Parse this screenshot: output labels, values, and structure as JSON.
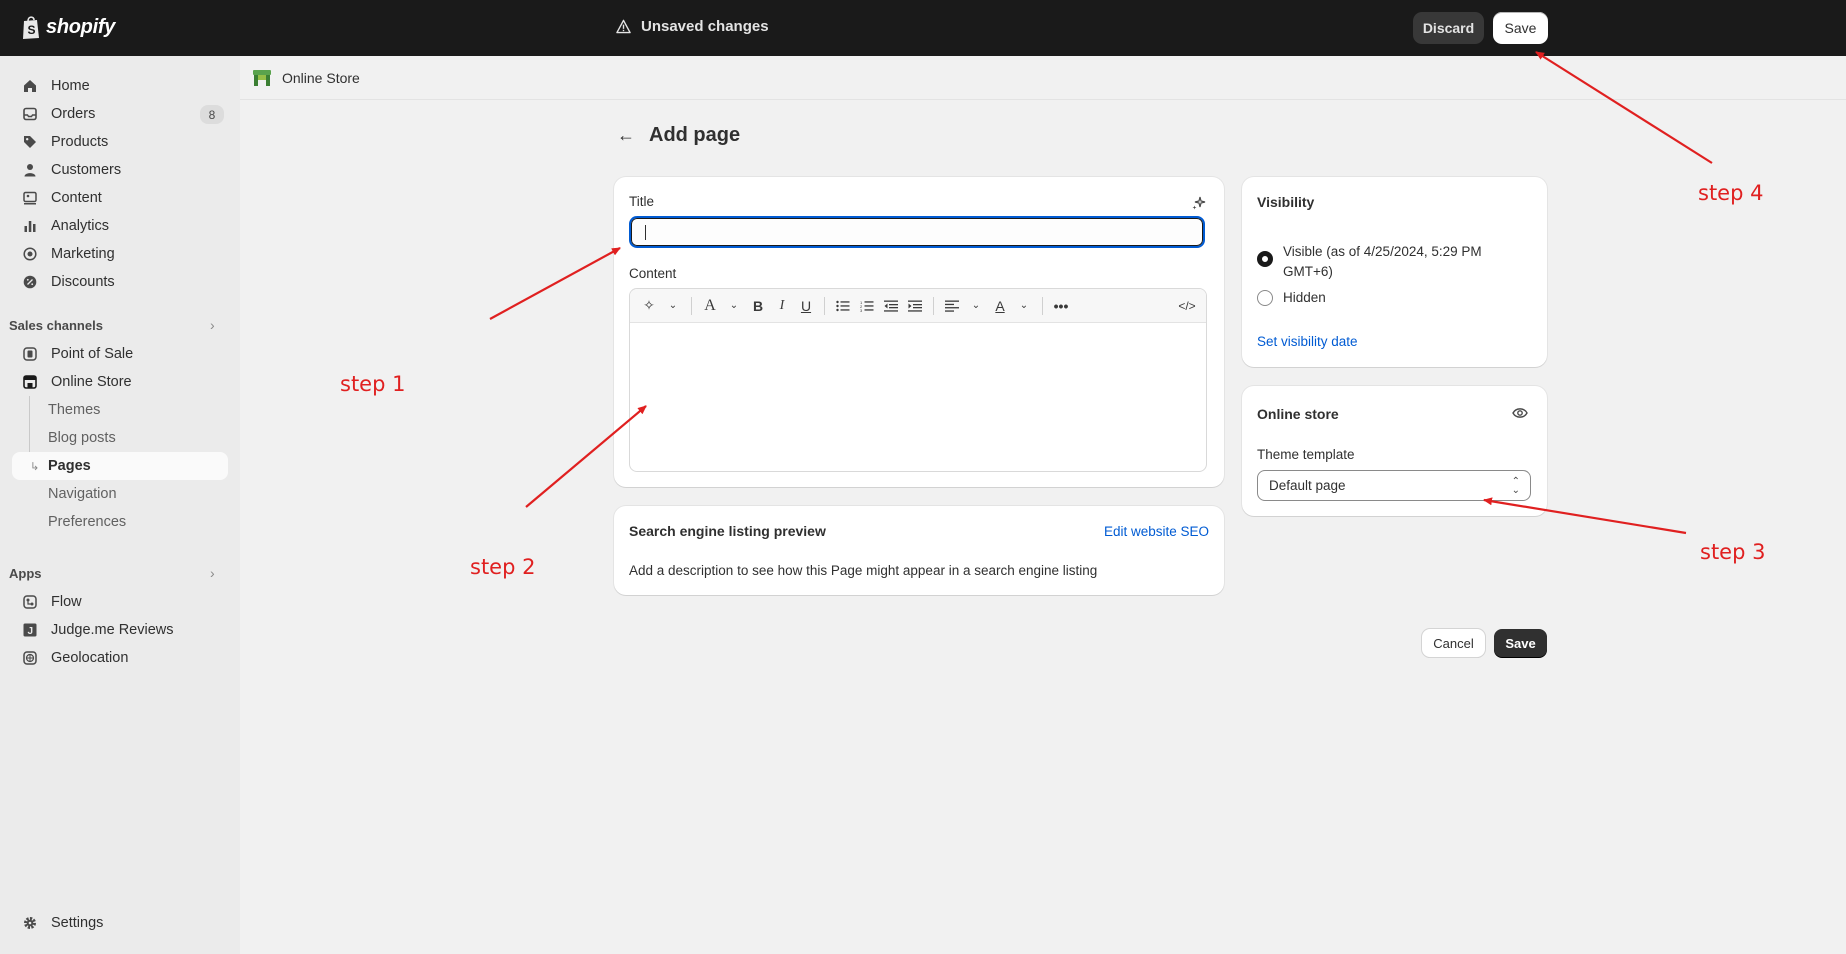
{
  "topbar": {
    "logo_text": "shopify",
    "unsaved_text": "Unsaved changes",
    "discard_label": "Discard",
    "save_label": "Save"
  },
  "sidebar": {
    "items": [
      {
        "label": "Home",
        "icon": "home-icon"
      },
      {
        "label": "Orders",
        "icon": "inbox-icon",
        "badge": "8"
      },
      {
        "label": "Products",
        "icon": "tag-icon"
      },
      {
        "label": "Customers",
        "icon": "person-icon"
      },
      {
        "label": "Content",
        "icon": "image-icon"
      },
      {
        "label": "Analytics",
        "icon": "chart-icon"
      },
      {
        "label": "Marketing",
        "icon": "target-icon"
      },
      {
        "label": "Discounts",
        "icon": "discount-icon"
      }
    ],
    "sales_channels_label": "Sales channels",
    "channels": [
      {
        "label": "Point of Sale",
        "icon": "pos-icon"
      },
      {
        "label": "Online Store",
        "icon": "store-icon"
      }
    ],
    "online_store_sub": [
      "Themes",
      "Blog posts",
      "Pages",
      "Navigation",
      "Preferences"
    ],
    "apps_label": "Apps",
    "apps": [
      {
        "label": "Flow",
        "icon": "flow-icon"
      },
      {
        "label": "Judge.me Reviews",
        "icon": "judgeme-icon"
      },
      {
        "label": "Geolocation",
        "icon": "globe-icon"
      }
    ],
    "settings_label": "Settings"
  },
  "subheader": {
    "label": "Online Store"
  },
  "page": {
    "title": "Add page",
    "title_field_label": "Title",
    "title_value": "",
    "content_label": "Content",
    "seo": {
      "heading": "Search engine listing preview",
      "edit_link": "Edit website SEO",
      "description": "Add a description to see how this Page might appear in a search engine listing"
    },
    "visibility": {
      "heading": "Visibility",
      "visible_label_line1": "Visible (as of 4/25/2024, 5:29 PM",
      "visible_label_line2": "GMT+6)",
      "hidden_label": "Hidden",
      "set_date_link": "Set visibility date"
    },
    "online_store": {
      "heading": "Online store",
      "template_label": "Theme template",
      "template_value": "Default page"
    },
    "cancel_label": "Cancel",
    "save_label": "Save"
  },
  "annotations": {
    "step1": "step 1",
    "step2": "step 2",
    "step3": "step 3",
    "step4": "step 4",
    "color": "#e02020"
  }
}
